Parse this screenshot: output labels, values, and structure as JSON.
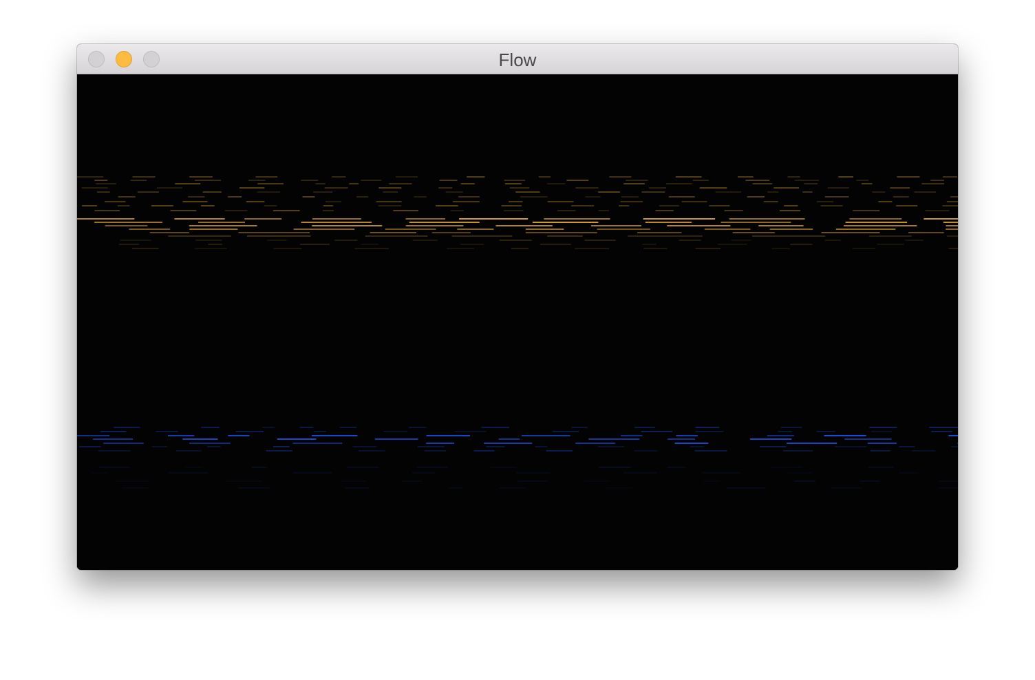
{
  "window": {
    "title": "Flow"
  },
  "traffic_lights": {
    "close_color": "#d3d1d4",
    "minimize_color": "#fdbc40",
    "zoom_color": "#d3d1d4"
  },
  "canvas": {
    "background": "#030303",
    "upper_band_color": "#f5b73c",
    "lower_band_color": "#1f5bff"
  }
}
